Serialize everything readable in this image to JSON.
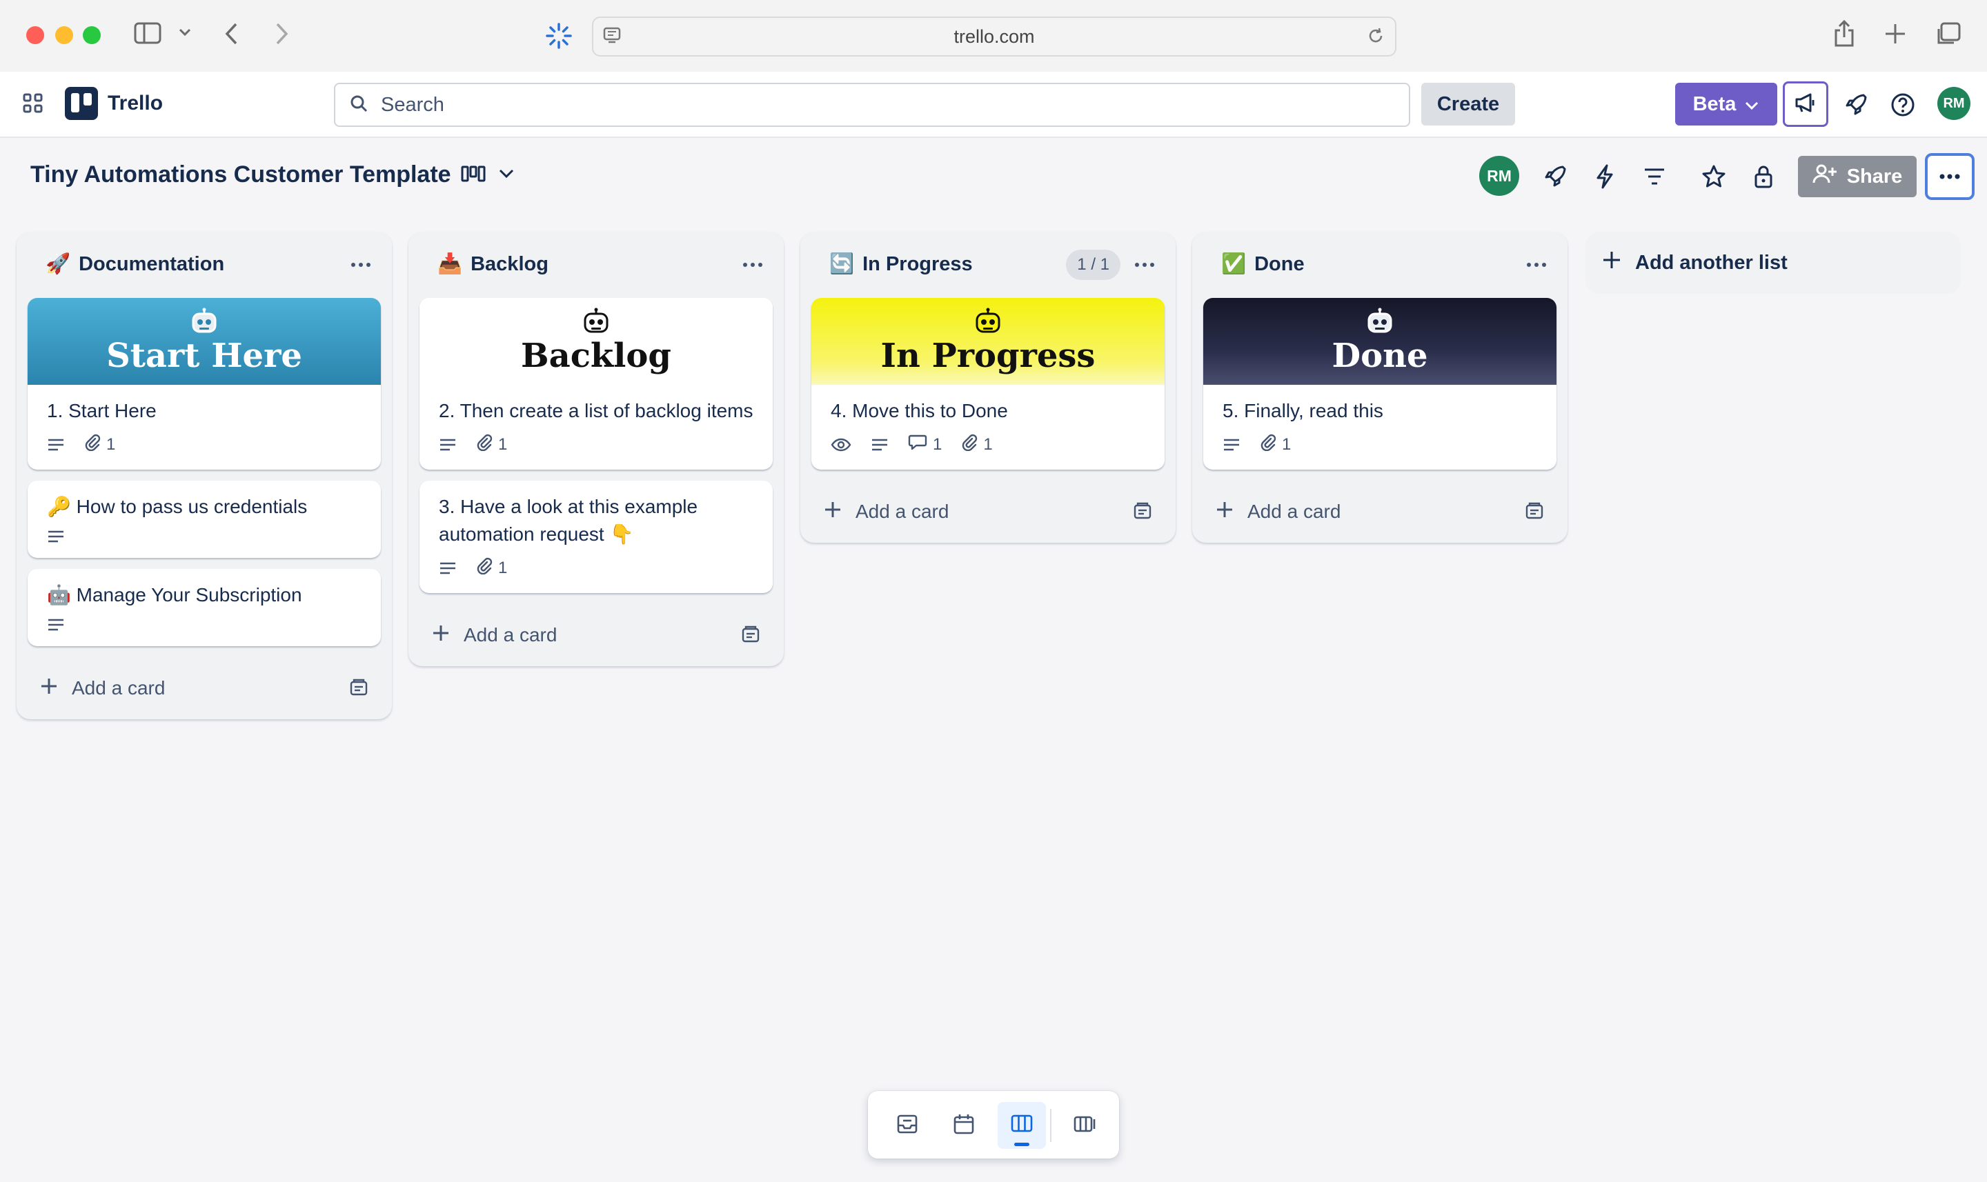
{
  "browser": {
    "url": "trello.com"
  },
  "header": {
    "app_name": "Trello",
    "search_placeholder": "Search",
    "create_label": "Create",
    "beta_label": "Beta",
    "avatar_initials": "RM"
  },
  "board": {
    "title": "Tiny Automations Customer Template",
    "member_initials": "RM",
    "share_label": "Share",
    "add_list_label": "Add another list"
  },
  "lists": [
    {
      "title": "Documentation",
      "emoji": "🚀",
      "add_card_label": "Add a card",
      "cards": [
        {
          "title": "1. Start Here",
          "cover_text": "Start Here",
          "attachments": "1"
        },
        {
          "title": "How to pass us credentials",
          "emoji": "🔑"
        },
        {
          "title": "Manage Your Subscription",
          "emoji": "🤖"
        }
      ]
    },
    {
      "title": "Backlog",
      "emoji": "📥",
      "add_card_label": "Add a card",
      "cards": [
        {
          "title": "2. Then create a list of backlog items",
          "cover_text": "Backlog",
          "attachments": "1"
        },
        {
          "title": "3. Have a look at this example automation request 👇",
          "attachments": "1"
        }
      ]
    },
    {
      "title": "In Progress",
      "emoji": "🔄",
      "count_badge": "1 / 1",
      "add_card_label": "Add a card",
      "cards": [
        {
          "title": "4. Move this to Done",
          "cover_text": "In Progress",
          "comments": "1",
          "attachments": "1"
        }
      ]
    },
    {
      "title": "Done",
      "emoji": "✅",
      "add_card_label": "Add a card",
      "cards": [
        {
          "title": "5. Finally, read this",
          "cover_text": "Done",
          "attachments": "1"
        }
      ]
    }
  ],
  "colors": {
    "beta_purple": "#6e5dc6",
    "avatar_green": "#1f845a",
    "focus_blue": "#4f7fdc",
    "cover_start_here": "#2f8fb8",
    "cover_in_progress": "#f7f21a",
    "cover_done": "#1e2139"
  }
}
